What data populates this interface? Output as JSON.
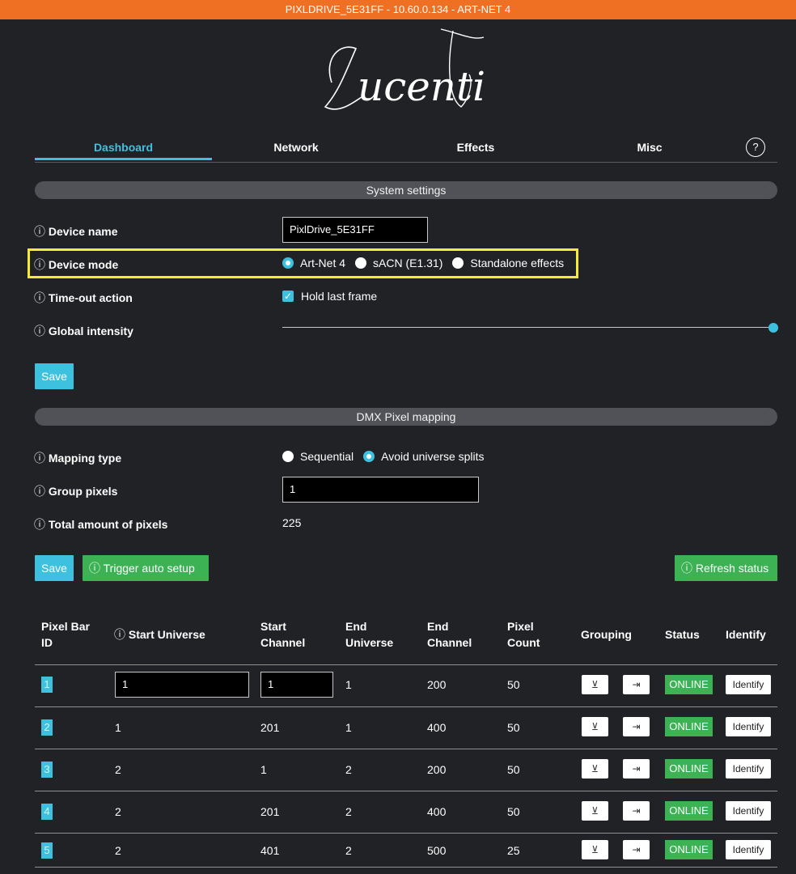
{
  "topbar": {
    "title": "PIXLDRIVE_5E31FF - 10.60.0.134 - ART-NET 4"
  },
  "logo": {
    "text": "Lucenti"
  },
  "tabs": [
    {
      "label": "Dashboard",
      "active": true
    },
    {
      "label": "Network"
    },
    {
      "label": "Effects"
    },
    {
      "label": "Misc"
    }
  ],
  "help": {
    "icon": "help-icon",
    "label": "?"
  },
  "system": {
    "section_title": "System settings",
    "device_name_label": "Device name",
    "device_name_value": "PixlDrive_5E31FF",
    "device_mode_label": "Device mode",
    "device_mode_options": [
      "Art-Net 4",
      "sACN (E1.31)",
      "Standalone effects"
    ],
    "device_mode_selected": "Art-Net 4",
    "timeout_label": "Time-out action",
    "timeout_option": "Hold last frame",
    "timeout_checked": true,
    "intensity_label": "Global intensity",
    "intensity_level_percent": 100,
    "save_label": "Save"
  },
  "dmx": {
    "section_title": "DMX Pixel mapping",
    "mapping_type_label": "Mapping type",
    "mapping_options": [
      "Sequential",
      "Avoid universe splits"
    ],
    "mapping_selected": "Avoid universe splits",
    "group_pixels_label": "Group pixels",
    "group_pixels_value": "1",
    "total_pixels_label": "Total amount of pixels",
    "total_pixels_value": "225",
    "save_label": "Save",
    "auto_setup_label": "Trigger auto setup",
    "refresh_label": "Refresh status"
  },
  "table": {
    "headers": {
      "id": [
        "Pixel Bar",
        "ID"
      ],
      "start_universe": "Start Universe",
      "start_channel": [
        "Start",
        "Channel"
      ],
      "end_universe": [
        "End",
        "Universe"
      ],
      "end_channel": [
        "End",
        "Channel"
      ],
      "pixel_count": [
        "Pixel",
        "Count"
      ],
      "grouping": "Grouping",
      "status": "Status",
      "identify": "Identify"
    },
    "rows": [
      {
        "id": "1",
        "start_universe": "1",
        "start_channel": "1",
        "end_universe": "1",
        "end_channel": "200",
        "pixel_count": "50",
        "status": "ONLINE",
        "identify": "Identify"
      },
      {
        "id": "2",
        "start_universe": "1",
        "start_channel": "201",
        "end_universe": "1",
        "end_channel": "400",
        "pixel_count": "50",
        "status": "ONLINE",
        "identify": "Identify"
      },
      {
        "id": "3",
        "start_universe": "2",
        "start_channel": "1",
        "end_universe": "2",
        "end_channel": "200",
        "pixel_count": "50",
        "status": "ONLINE",
        "identify": "Identify"
      },
      {
        "id": "4",
        "start_universe": "2",
        "start_channel": "201",
        "end_universe": "2",
        "end_channel": "400",
        "pixel_count": "50",
        "status": "ONLINE",
        "identify": "Identify"
      },
      {
        "id": "5",
        "start_universe": "2",
        "start_channel": "401",
        "end_universe": "2",
        "end_channel": "500",
        "pixel_count": "25",
        "status": "ONLINE",
        "identify": "Identify"
      }
    ],
    "grouping_icons": [
      "align-bottom-icon",
      "align-right-icon"
    ]
  },
  "colors": {
    "accent": "#3ec1de",
    "topbar": "#ef7022",
    "online": "#3db254",
    "highlight": "#f6ec35",
    "background": "#202225"
  }
}
